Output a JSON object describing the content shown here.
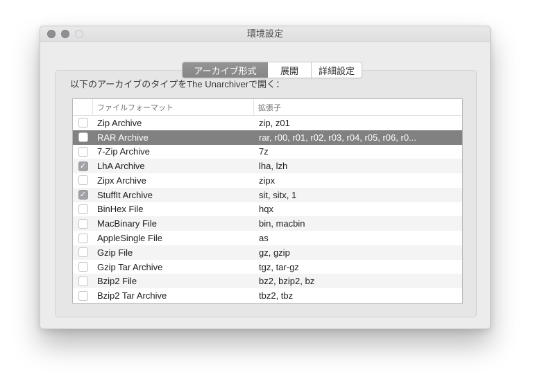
{
  "window": {
    "title": "環境設定"
  },
  "titlebar_buttons": [
    "close-button",
    "minimize-button",
    "zoom-button"
  ],
  "tabs": [
    {
      "id": "archive-formats",
      "label": "アーカイブ形式",
      "selected": true
    },
    {
      "id": "extraction",
      "label": "展開",
      "selected": false
    },
    {
      "id": "advanced",
      "label": "詳細設定",
      "selected": false
    }
  ],
  "intro_label": "以下のアーカイブのタイプをThe Unarchiverで開く：",
  "table": {
    "columns": [
      "ファイルフォーマット",
      "拡張子"
    ],
    "rows": [
      {
        "checked": false,
        "selected": false,
        "format": "Zip Archive",
        "extensions": "zip, z01"
      },
      {
        "checked": false,
        "selected": true,
        "format": "RAR Archive",
        "extensions": "rar, r00, r01, r02, r03, r04, r05, r06, r0..."
      },
      {
        "checked": false,
        "selected": false,
        "format": "7-Zip Archive",
        "extensions": "7z"
      },
      {
        "checked": true,
        "selected": false,
        "format": "LhA Archive",
        "extensions": "lha, lzh"
      },
      {
        "checked": false,
        "selected": false,
        "format": "Zipx Archive",
        "extensions": "zipx"
      },
      {
        "checked": true,
        "selected": false,
        "format": "StuffIt Archive",
        "extensions": "sit, sitx, 1"
      },
      {
        "checked": false,
        "selected": false,
        "format": "BinHex File",
        "extensions": "hqx"
      },
      {
        "checked": false,
        "selected": false,
        "format": "MacBinary File",
        "extensions": "bin, macbin"
      },
      {
        "checked": false,
        "selected": false,
        "format": "AppleSingle File",
        "extensions": "as"
      },
      {
        "checked": false,
        "selected": false,
        "format": "Gzip File",
        "extensions": "gz, gzip"
      },
      {
        "checked": false,
        "selected": false,
        "format": "Gzip Tar Archive",
        "extensions": "tgz, tar-gz"
      },
      {
        "checked": false,
        "selected": false,
        "format": "Bzip2 File",
        "extensions": "bz2, bzip2, bz"
      },
      {
        "checked": false,
        "selected": false,
        "format": "Bzip2 Tar Archive",
        "extensions": "tbz2, tbz"
      }
    ]
  },
  "colors": {
    "window_background": "#ececec",
    "tab_box_background": "#e6e6e6",
    "selected_row": "#818181",
    "selected_segment": "#8a8a8a",
    "alt_row": "#f4f4f5",
    "checked_checkbox": "#a2a2a7"
  }
}
